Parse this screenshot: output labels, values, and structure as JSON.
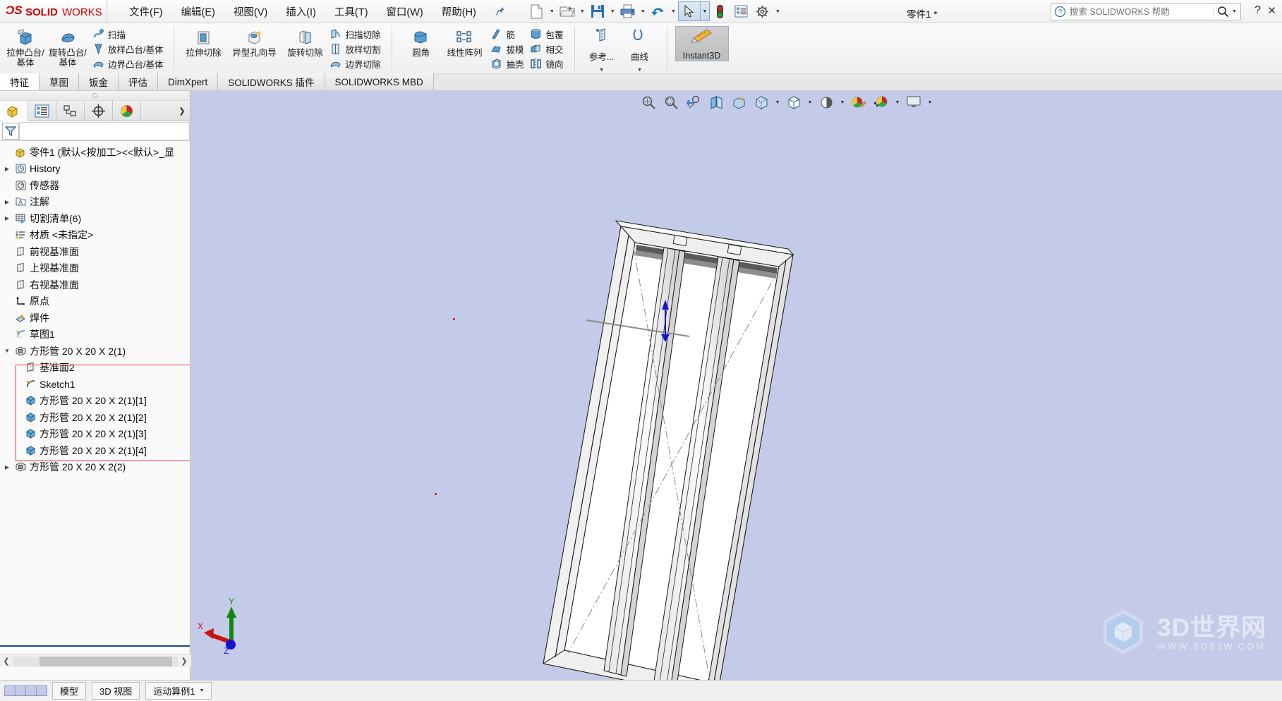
{
  "app": {
    "brand_ds": "DS",
    "brand_solid": "SOLID",
    "brand_works": "WORKS",
    "document_title": "零件1 *"
  },
  "menubar": {
    "items": [
      {
        "label": "文件(F)",
        "name": "menu-file"
      },
      {
        "label": "编辑(E)",
        "name": "menu-edit"
      },
      {
        "label": "视图(V)",
        "name": "menu-view"
      },
      {
        "label": "插入(I)",
        "name": "menu-insert"
      },
      {
        "label": "工具(T)",
        "name": "menu-tools"
      },
      {
        "label": "窗口(W)",
        "name": "menu-window"
      },
      {
        "label": "帮助(H)",
        "name": "menu-help"
      }
    ],
    "pin_icon": "pushpin-icon"
  },
  "quick_access": {
    "buttons": [
      {
        "name": "new-document-button",
        "icon": "new-file-icon",
        "dropdown": true
      },
      {
        "name": "open-document-button",
        "icon": "open-folder-icon",
        "dropdown": true
      },
      {
        "name": "save-button",
        "icon": "floppy-disk-icon",
        "dropdown": true
      },
      {
        "name": "print-button",
        "icon": "printer-icon",
        "dropdown": true
      },
      {
        "name": "undo-button",
        "icon": "undo-arrow-icon",
        "dropdown": true
      },
      {
        "name": "select-button",
        "icon": "cursor-arrow-icon",
        "dropdown": true,
        "selected": true
      },
      {
        "name": "rebuild-button",
        "icon": "traffic-light-icon",
        "dropdown": false
      },
      {
        "name": "file-properties-button",
        "icon": "properties-list-icon",
        "dropdown": false
      },
      {
        "name": "options-button",
        "icon": "gear-icon",
        "dropdown": true
      }
    ]
  },
  "help_search": {
    "placeholder": "搜索 SOLIDWORKS 帮助",
    "value": "",
    "question_icon": "question-circle-icon",
    "magnifier_icon": "magnifier-icon"
  },
  "ribbon": {
    "groups": [
      {
        "name": "features-boss-group",
        "big": [
          {
            "label": "拉伸凸台/基体",
            "name": "extruded-boss-base-command",
            "icon": "extrude-boss-icon"
          },
          {
            "label": "旋转凸台/基体",
            "name": "revolved-boss-base-command",
            "icon": "revolve-boss-icon"
          }
        ],
        "small": [
          {
            "label": "扫描",
            "name": "swept-boss-command",
            "icon": "sweep-icon"
          },
          {
            "label": "放样凸台/基体",
            "name": "lofted-boss-command",
            "icon": "loft-icon"
          },
          {
            "label": "边界凸台/基体",
            "name": "boundary-boss-command",
            "icon": "boundary-icon"
          }
        ]
      },
      {
        "name": "features-cut-group",
        "big": [
          {
            "label": "拉伸切除",
            "name": "extruded-cut-command",
            "icon": "extrude-cut-icon"
          },
          {
            "label": "异型孔向导",
            "name": "hole-wizard-command",
            "icon": "hole-wizard-icon",
            "wide": true
          },
          {
            "label": "旋转切除",
            "name": "revolved-cut-command",
            "icon": "revolve-cut-icon"
          }
        ],
        "small": [
          {
            "label": "扫描切除",
            "name": "swept-cut-command",
            "icon": "sweep-cut-icon"
          },
          {
            "label": "放样切割",
            "name": "lofted-cut-command",
            "icon": "loft-cut-icon"
          },
          {
            "label": "边界切除",
            "name": "boundary-cut-command",
            "icon": "boundary-cut-icon"
          }
        ]
      },
      {
        "name": "features-pattern-group",
        "big": [
          {
            "label": "圆角",
            "name": "fillet-command",
            "icon": "fillet-icon"
          },
          {
            "label": "线性阵列",
            "name": "linear-pattern-command",
            "icon": "linear-pattern-icon"
          }
        ],
        "small": [
          {
            "label": "筋",
            "name": "rib-command",
            "icon": "rib-icon"
          },
          {
            "label": "拔模",
            "name": "draft-command",
            "icon": "draft-icon"
          },
          {
            "label": "抽壳",
            "name": "shell-command",
            "icon": "shell-icon"
          }
        ],
        "small2": [
          {
            "label": "包覆",
            "name": "wrap-command",
            "icon": "wrap-icon"
          },
          {
            "label": "相交",
            "name": "intersect-command",
            "icon": "intersect-icon"
          },
          {
            "label": "镜向",
            "name": "mirror-command",
            "icon": "mirror-icon"
          }
        ]
      },
      {
        "name": "reference-group",
        "dropdowns": [
          {
            "label": "参考...",
            "name": "reference-geometry-command",
            "icon": "reference-plane-icon"
          },
          {
            "label": "曲线",
            "name": "curves-command",
            "icon": "curve-icon"
          }
        ]
      },
      {
        "name": "instant3d-group",
        "toggle": {
          "label": "Instant3D",
          "name": "instant3d-toggle",
          "icon": "instant3d-icon",
          "active": true
        }
      }
    ]
  },
  "tabs": [
    {
      "label": "特征",
      "name": "tab-features",
      "active": true
    },
    {
      "label": "草图",
      "name": "tab-sketch",
      "active": false
    },
    {
      "label": "钣金",
      "name": "tab-sheetmetal",
      "active": false
    },
    {
      "label": "评估",
      "name": "tab-evaluate",
      "active": false
    },
    {
      "label": "DimXpert",
      "name": "tab-dimxpert",
      "active": false
    },
    {
      "label": "SOLIDWORKS 插件",
      "name": "tab-solidworks-addins",
      "active": false
    },
    {
      "label": "SOLIDWORKS MBD",
      "name": "tab-solidworks-mbd",
      "active": false
    }
  ],
  "manager_tabs": [
    {
      "name": "tab-feature-manager",
      "icon": "feature-tree-icon",
      "active": true
    },
    {
      "name": "tab-property-manager",
      "icon": "property-manager-icon",
      "active": false
    },
    {
      "name": "tab-configuration-manager",
      "icon": "configuration-manager-icon",
      "active": false
    },
    {
      "name": "tab-dimxpert-manager",
      "icon": "dimxpert-manager-icon",
      "active": false
    },
    {
      "name": "tab-display-manager",
      "icon": "display-manager-icon",
      "active": false
    }
  ],
  "filter": {
    "icon": "filter-funnel-icon",
    "placeholder": "",
    "value": ""
  },
  "tree": {
    "root": {
      "label": "零件1  (默认<按加工><<默认>_显",
      "name": "tree-root-part",
      "icon": "part-icon"
    },
    "items": [
      {
        "label": "History",
        "name": "tree-item-history",
        "icon": "history-icon",
        "indent": 0,
        "twist": "right"
      },
      {
        "label": "传感器",
        "name": "tree-item-sensors",
        "icon": "sensor-icon",
        "indent": 0,
        "twist": ""
      },
      {
        "label": "注解",
        "name": "tree-item-annotations",
        "icon": "annotations-icon",
        "indent": 0,
        "twist": "right"
      },
      {
        "label": "切割清单(6)",
        "name": "tree-item-cut-list",
        "icon": "cut-list-icon",
        "indent": 0,
        "twist": "right"
      },
      {
        "label": "材质 <未指定>",
        "name": "tree-item-material",
        "icon": "material-icon",
        "indent": 0,
        "twist": ""
      },
      {
        "label": "前视基准面",
        "name": "tree-item-front-plane",
        "icon": "plane-icon",
        "indent": 0,
        "twist": ""
      },
      {
        "label": "上视基准面",
        "name": "tree-item-top-plane",
        "icon": "plane-icon",
        "indent": 0,
        "twist": ""
      },
      {
        "label": "右视基准面",
        "name": "tree-item-right-plane",
        "icon": "plane-icon",
        "indent": 0,
        "twist": ""
      },
      {
        "label": "原点",
        "name": "tree-item-origin",
        "icon": "origin-icon",
        "indent": 0,
        "twist": ""
      },
      {
        "label": "焊件",
        "name": "tree-item-weldment",
        "icon": "weldment-icon",
        "indent": 0,
        "twist": ""
      },
      {
        "label": "草图1",
        "name": "tree-item-sketch1",
        "icon": "sketch-icon",
        "indent": 0,
        "twist": ""
      },
      {
        "label": "方形管 20 X 20 X 2(1)",
        "name": "tree-item-square-tube-1",
        "icon": "structural-member-icon",
        "indent": 0,
        "twist": "down"
      },
      {
        "label": "基准面2",
        "name": "tree-item-plane2",
        "icon": "plane-icon",
        "indent": 1,
        "twist": ""
      },
      {
        "label": "Sketch1",
        "name": "tree-item-sketch1-sub",
        "icon": "sketch-icon",
        "indent": 1,
        "twist": ""
      },
      {
        "label": "方形管 20 X 20 X 2(1)[1]",
        "name": "tree-item-square-tube-1-1",
        "icon": "solid-body-icon",
        "indent": 1,
        "twist": ""
      },
      {
        "label": "方形管 20 X 20 X 2(1)[2]",
        "name": "tree-item-square-tube-1-2",
        "icon": "solid-body-icon",
        "indent": 1,
        "twist": ""
      },
      {
        "label": "方形管 20 X 20 X 2(1)[3]",
        "name": "tree-item-square-tube-1-3",
        "icon": "solid-body-icon",
        "indent": 1,
        "twist": ""
      },
      {
        "label": "方形管 20 X 20 X 2(1)[4]",
        "name": "tree-item-square-tube-1-4",
        "icon": "solid-body-icon",
        "indent": 1,
        "twist": ""
      },
      {
        "label": "方形管 20 X 20 X 2(2)",
        "name": "tree-item-square-tube-2",
        "icon": "structural-member-icon",
        "indent": 0,
        "twist": "right"
      }
    ]
  },
  "view_toolbar": {
    "buttons": [
      {
        "name": "zoom-to-fit-button",
        "icon": "zoom-fit-icon",
        "caret": false
      },
      {
        "name": "zoom-to-area-button",
        "icon": "zoom-area-icon",
        "caret": false
      },
      {
        "name": "previous-view-button",
        "icon": "previous-view-icon",
        "caret": false
      },
      {
        "name": "section-view-button",
        "icon": "section-view-icon",
        "caret": false
      },
      {
        "name": "view-orientation-button",
        "icon": "view-orientation-icon",
        "caret": false
      },
      {
        "name": "display-style-button",
        "icon": "display-style-icon",
        "caret": true
      },
      {
        "name": "hide-show-items-button",
        "icon": "hide-show-icon",
        "caret": true
      },
      {
        "name": "edit-appearance-button",
        "icon": "appearance-icon",
        "caret": true
      },
      {
        "name": "apply-scene-button",
        "icon": "scene-icon",
        "caret": true
      },
      {
        "name": "view-settings-button",
        "icon": "view-settings-icon",
        "caret": true
      }
    ]
  },
  "triad": {
    "x_label": "X",
    "y_label": "Y",
    "z_label": "Z",
    "x_color": "#cc1111",
    "y_color": "#118811",
    "z_color": "#1111cc"
  },
  "watermark": {
    "title": "3D世界网",
    "url": "WWW.3DSJW.COM",
    "icon": "hexagon-cube-icon"
  },
  "statusbar": {
    "cells": [
      {
        "label": "模型",
        "name": "status-tab-model"
      },
      {
        "label": "3D 视图",
        "name": "status-tab-3d-views"
      },
      {
        "label": "运动算例1",
        "name": "status-tab-motion-study"
      }
    ]
  },
  "colors": {
    "graphics_background": "#c3cbe8",
    "accent_red": "#e03a3a",
    "brand_red": "#cc0000",
    "tree_selection": "#1b4b8f"
  }
}
